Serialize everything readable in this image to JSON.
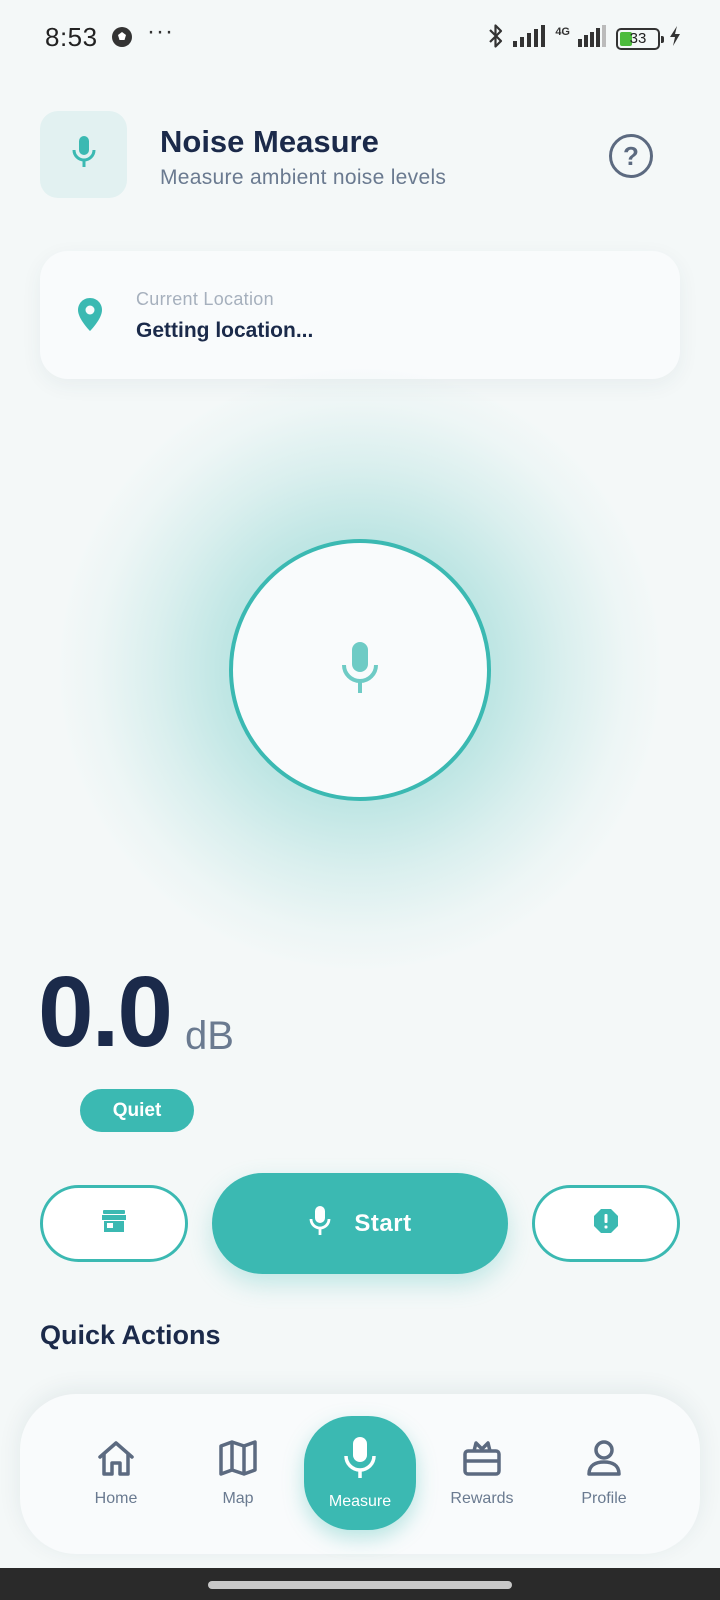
{
  "status_bar": {
    "time": "8:53",
    "more": "···",
    "network": "4G",
    "battery": "33"
  },
  "header": {
    "title": "Noise Measure",
    "subtitle": "Measure ambient noise levels",
    "help_icon": "?"
  },
  "location": {
    "label": "Current Location",
    "value": "Getting location..."
  },
  "reading": {
    "value": "0.0",
    "unit": "dB",
    "level": "Quiet"
  },
  "actions": {
    "start_label": "Start"
  },
  "quick_actions": {
    "title": "Quick Actions"
  },
  "nav": {
    "items": [
      {
        "label": "Home",
        "icon": "home-icon",
        "active": false
      },
      {
        "label": "Map",
        "icon": "map-icon",
        "active": false
      },
      {
        "label": "Measure",
        "icon": "mic-icon",
        "active": true
      },
      {
        "label": "Rewards",
        "icon": "gift-icon",
        "active": false
      },
      {
        "label": "Profile",
        "icon": "person-icon",
        "active": false
      }
    ]
  },
  "colors": {
    "accent": "#3bb9b2",
    "text_dark": "#1b2a4a",
    "text_muted": "#6a7a90",
    "background": "#f4f8f8"
  }
}
